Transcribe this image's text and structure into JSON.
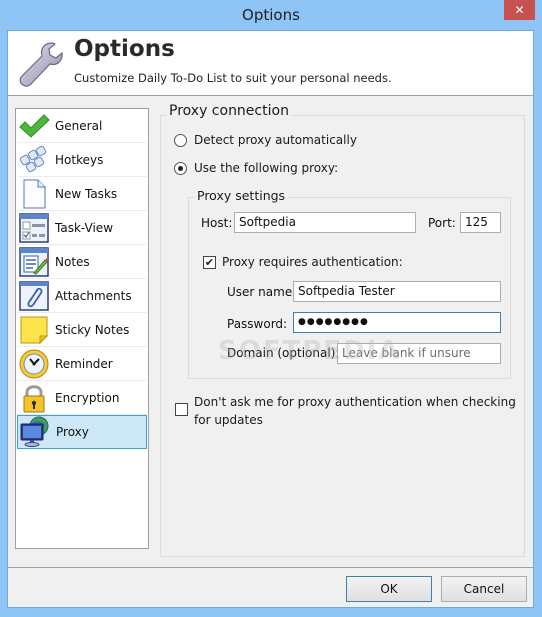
{
  "window": {
    "title": "Options",
    "close_label": "✕"
  },
  "header": {
    "title": "Options",
    "subtitle": "Customize Daily To-Do List to suit your personal needs.",
    "icon": "wrench-icon"
  },
  "sidebar": {
    "items": [
      {
        "label": "General",
        "icon": "checkmark-icon",
        "active": false
      },
      {
        "label": "Hotkeys",
        "icon": "keyboard-keys-icon",
        "active": false
      },
      {
        "label": "New Tasks",
        "icon": "blank-page-icon",
        "active": false
      },
      {
        "label": "Task-View",
        "icon": "task-view-icon",
        "active": false
      },
      {
        "label": "Notes",
        "icon": "notes-pencil-icon",
        "active": false
      },
      {
        "label": "Attachments",
        "icon": "paperclip-icon",
        "active": false
      },
      {
        "label": "Sticky Notes",
        "icon": "sticky-note-icon",
        "active": false
      },
      {
        "label": "Reminder",
        "icon": "clock-icon",
        "active": false
      },
      {
        "label": "Encryption",
        "icon": "padlock-icon",
        "active": false
      },
      {
        "label": "Proxy",
        "icon": "globe-monitor-icon",
        "active": true
      }
    ]
  },
  "proxy": {
    "group_title": "Proxy connection",
    "detect_auto_label": "Detect proxy automatically",
    "detect_auto_checked": false,
    "use_following_label": "Use the following proxy:",
    "use_following_checked": true,
    "settings": {
      "group_title": "Proxy settings",
      "host_label": "Host:",
      "host_value": "Softpedia",
      "port_label": "Port:",
      "port_value": "125",
      "auth_label": "Proxy requires authentication:",
      "auth_checked": true,
      "username_label": "User name:",
      "username_value": "Softpedia Tester",
      "password_label": "Password:",
      "password_value": "●●●●●●●●",
      "domain_label": "Domain (optional):",
      "domain_placeholder": "Leave blank if unsure"
    },
    "dont_ask_label_line1": "Don't ask me for proxy authentication when checking",
    "dont_ask_label_line2": "for updates",
    "dont_ask_checked": false
  },
  "footer": {
    "ok_label": "OK",
    "cancel_label": "Cancel"
  },
  "watermark": "SOFTPEDIA"
}
